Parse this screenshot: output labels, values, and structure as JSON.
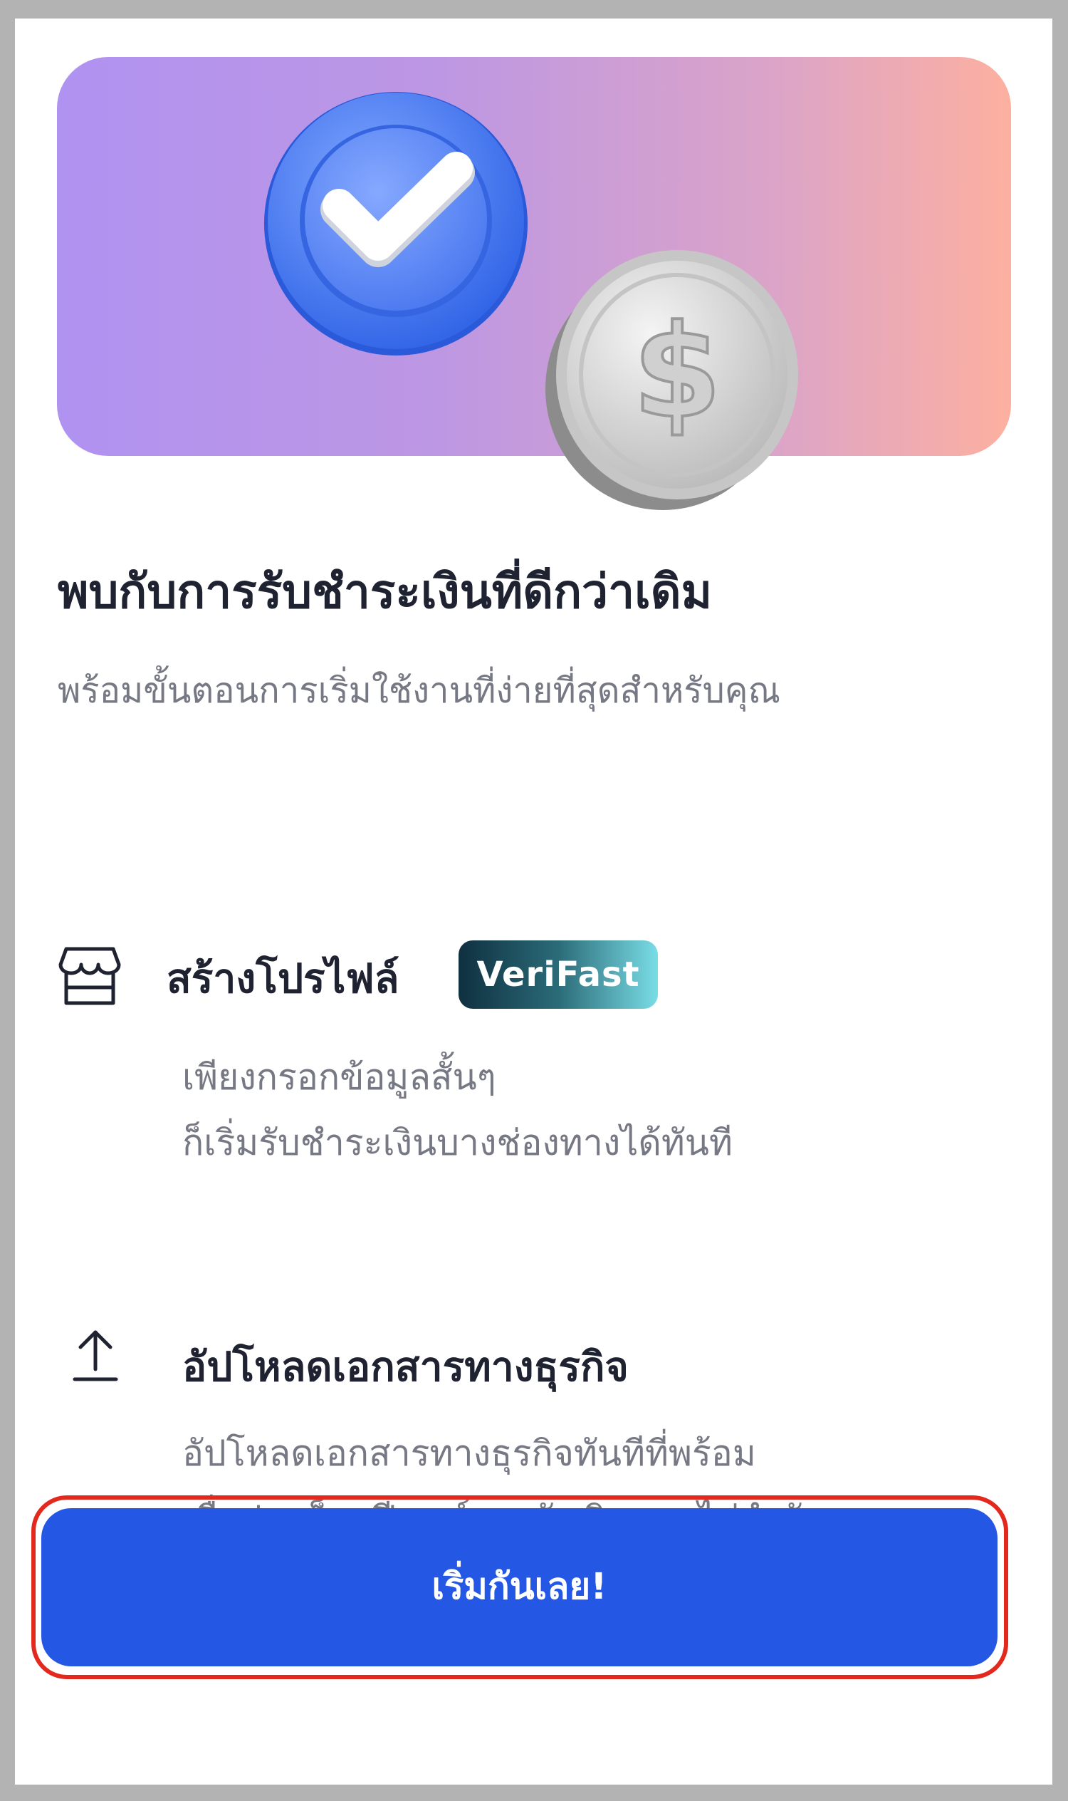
{
  "hero": {
    "check_icon": "check-badge-icon",
    "coin_icon": "dollar-coin-icon",
    "gradient_start": "#b092f1",
    "gradient_end": "#fdb0a0"
  },
  "title": "พบกับการรับชำระเงินที่ดีกว่าเดิม",
  "subtitle": "พร้อมขั้นตอนการเริ่มใช้งานที่ง่ายที่สุดสำหรับคุณ",
  "features": [
    {
      "icon": "store-icon",
      "title": "สร้างโปรไฟล์",
      "badge": "VeriFast",
      "lines": [
        "เพียงกรอกข้อมูลสั้นๆ",
        "ก็เริ่มรับชำระเงินบางช่องทางได้ทันที"
      ]
    },
    {
      "icon": "upload-icon",
      "title": "อัปโหลดเอกสารทางธุรกิจ",
      "lines": [
        "อัปโหลดเอกสารทางธุรกิจทันทีที่พร้อม",
        "เพื่อปลดล็อกฟีเจอร์และรับเงินแบบไม่จำกัด"
      ]
    }
  ],
  "cta": {
    "label": "เริ่มกันเลย!",
    "color": "#2457e4",
    "highlight_color": "#e3281e"
  }
}
